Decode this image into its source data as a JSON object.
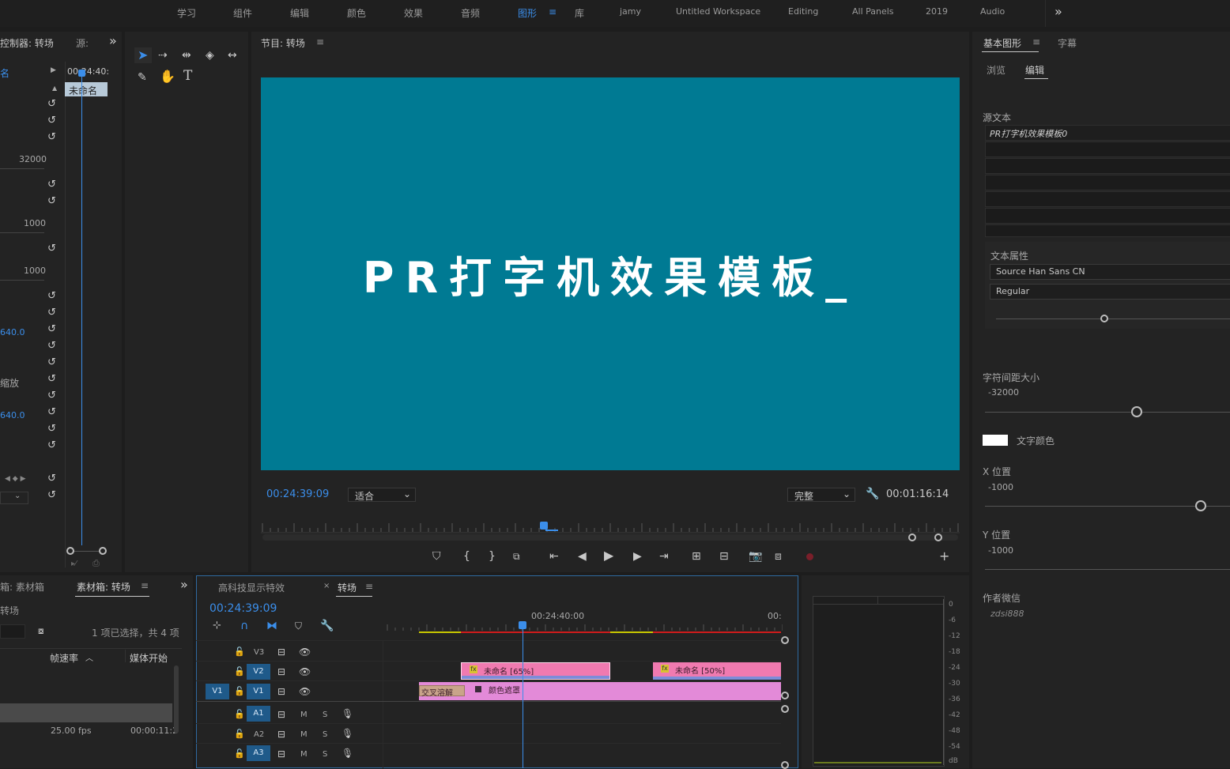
{
  "workspaces": [
    {
      "label": "学习"
    },
    {
      "label": "组件"
    },
    {
      "label": "编辑"
    },
    {
      "label": "颜色"
    },
    {
      "label": "效果"
    },
    {
      "label": "音频"
    },
    {
      "label": "图形",
      "active": true
    },
    {
      "label": "库"
    },
    {
      "label": "jamy"
    },
    {
      "label": "Untitled Workspace"
    },
    {
      "label": "Editing"
    },
    {
      "label": "All Panels"
    },
    {
      "label": "2019"
    },
    {
      "label": "Audio"
    }
  ],
  "workspace_menu_icon": "≡",
  "workspace_overflow_icon": "»",
  "effect_controls": {
    "tab_label": "控制器: 转场",
    "tab2_label": "源:",
    "col_name": "名",
    "timecode": "00:24:40:",
    "clip_name": "未命名",
    "values": {
      "v1": "32000",
      "v2": "1000",
      "v3": "1000",
      "v4": "640.0",
      "v5": "缩放",
      "v6": "640.0"
    }
  },
  "program_monitor": {
    "title": "节目: 转场",
    "overlay_text": "PR打字机效果模板_",
    "timecode": "00:24:39:09",
    "fit_select": "适合",
    "quality_select": "完整",
    "duration": "00:01:16:14"
  },
  "essential_graphics": {
    "tab_title": "基本图形",
    "tab_captions": "字幕",
    "subtab_browse": "浏览",
    "subtab_edit": "编辑",
    "source_text_label": "源文本",
    "layer_name": "PR打字机效果模板0",
    "text_props_label": "文本属性",
    "font": "Source Han Sans CN",
    "font_style": "Regular",
    "tracking_label": "字符间距大小",
    "tracking_value": "-32000",
    "tracking_level": 0.62,
    "color_label": "文字颜色",
    "color_value": "#ffffff",
    "x_label": "X 位置",
    "x_value": "-1000",
    "x_level": 0.88,
    "y_label": "Y 位置",
    "y_value": "-1000",
    "author_label": "作者微信",
    "author_value": "zdsi888",
    "font_size_level": 0.47
  },
  "project": {
    "tab1": "箱: 素材箱",
    "tab2": "素材箱: 转场",
    "bin_name": "转场",
    "selection_info": "1 项已选择，共 4 项",
    "col_framerate": "帧速率",
    "col_media_start": "媒体开始",
    "row_fps": "25.00 fps",
    "row_start": "00:00:11:2"
  },
  "timeline": {
    "tab1": "高科技显示特效",
    "tab2": "转场",
    "timecode": "00:24:39:09",
    "ruler_t1": "00:24:40:00",
    "ruler_t2": "00:",
    "tracks_video": [
      "V3",
      "V2",
      "V1"
    ],
    "tracks_audio": [
      "A1",
      "A2",
      "A3"
    ],
    "source_patch": "V1",
    "mute": "M",
    "solo": "S",
    "clips": [
      {
        "label": "未命名 [65%]",
        "kind": "graphic"
      },
      {
        "label": "未命名 [50%]",
        "kind": "graphic"
      },
      {
        "label": "交叉溶解",
        "kind": "transition"
      },
      {
        "label": "颜色遮罩",
        "kind": "matte"
      }
    ]
  },
  "audio_meter": {
    "scale": [
      "0",
      "-6",
      "-12",
      "-18",
      "-24",
      "-30",
      "-36",
      "-42",
      "-48",
      "-54",
      "dB"
    ]
  },
  "colors": {
    "accent": "#3b8eea",
    "video_bg": "#007a93",
    "clip_pink": "#e777b9",
    "clip_graphic": "#f07ab0"
  }
}
